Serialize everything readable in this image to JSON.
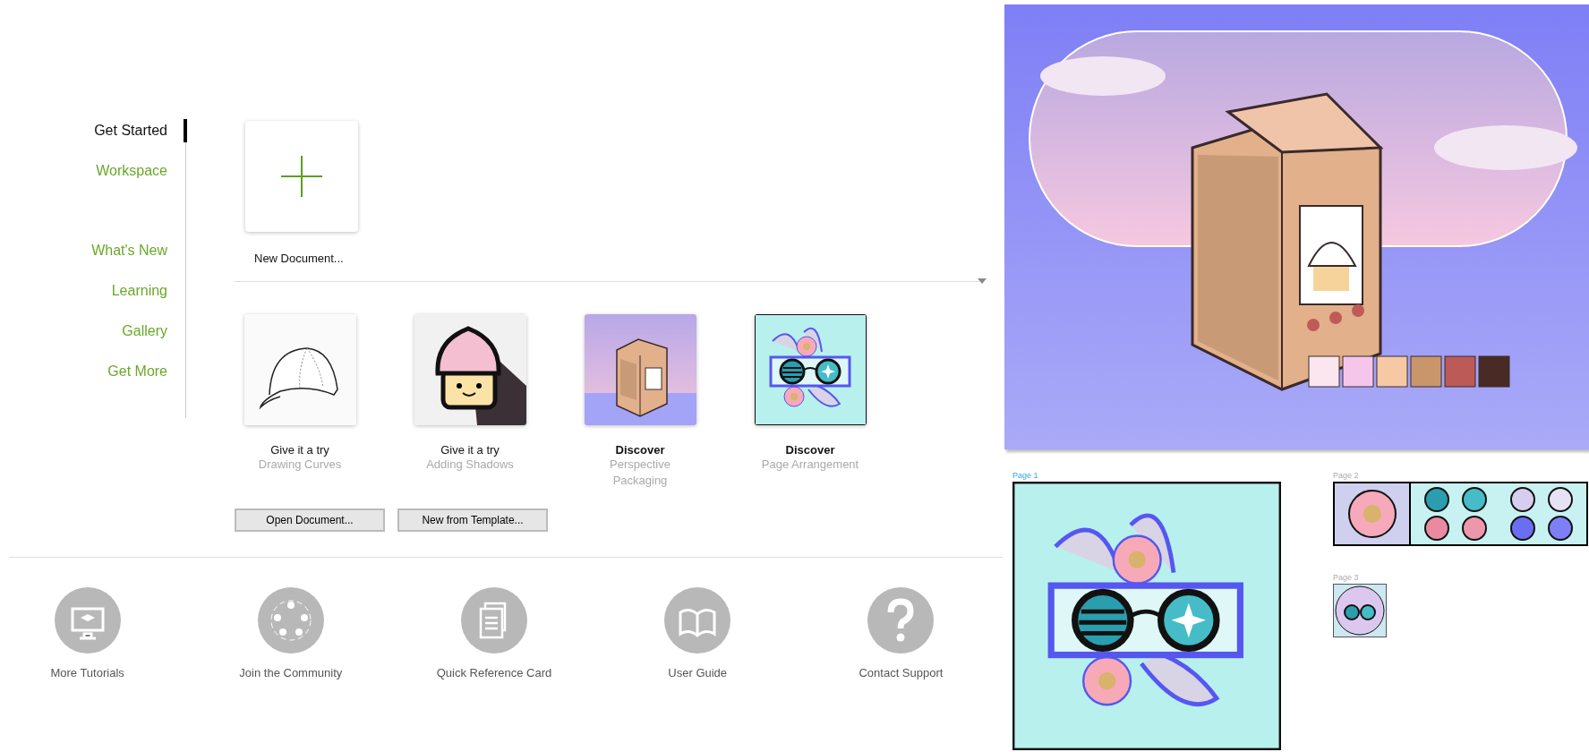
{
  "nav": {
    "primary": [
      {
        "label": "Get Started",
        "selected": true
      },
      {
        "label": "Workspace",
        "selected": false
      }
    ],
    "secondary": [
      {
        "label": "What's New",
        "selected": false
      },
      {
        "label": "Learning",
        "selected": false
      },
      {
        "label": "Gallery",
        "selected": false
      },
      {
        "label": "Get More",
        "selected": false
      }
    ]
  },
  "new_document": {
    "label": "New Document..."
  },
  "tiles": [
    {
      "kind": "cap",
      "title": "Give it a try",
      "subtitle": "Drawing Curves"
    },
    {
      "kind": "cupcake",
      "title": "Give it a try",
      "subtitle": "Adding Shadows"
    },
    {
      "kind": "carton",
      "title": "Discover",
      "subtitle": "Perspective Packaging"
    },
    {
      "kind": "glasses",
      "title": "Discover",
      "subtitle": "Page Arrangement"
    }
  ],
  "buttons": [
    "Open Document...",
    "New from Template..."
  ],
  "resources": [
    {
      "kind": "tutorials",
      "label": "More Tutorials"
    },
    {
      "kind": "community",
      "label": "Join the Community"
    },
    {
      "kind": "card",
      "label": "Quick Reference Card"
    },
    {
      "kind": "guide",
      "label": "User Guide"
    },
    {
      "kind": "support",
      "label": "Contact Support"
    }
  ],
  "pages": [
    {
      "label": "Page 1",
      "selected": true
    },
    {
      "label": "Page 2",
      "selected": false
    },
    {
      "label": "Page 3",
      "selected": false
    }
  ]
}
